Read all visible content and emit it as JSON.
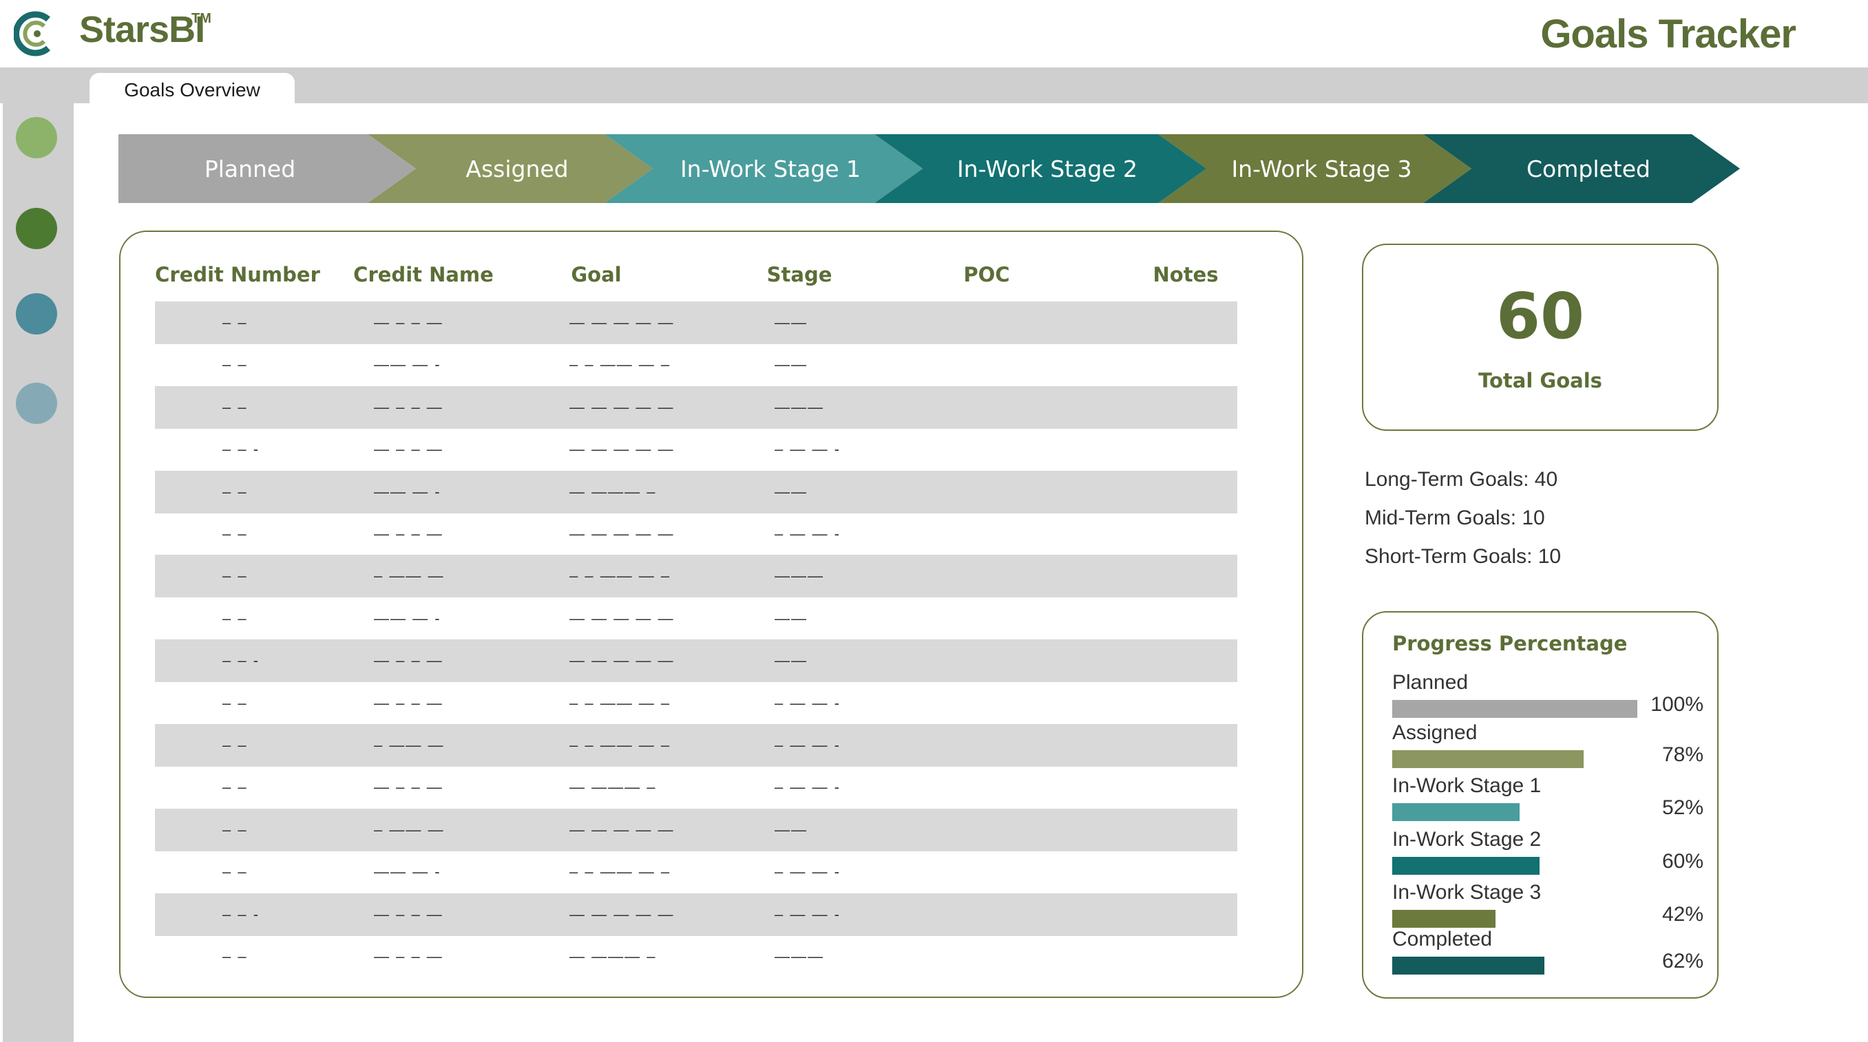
{
  "header": {
    "brand": "StarsBI",
    "trademark": "TM",
    "title": "Goals Tracker",
    "logo_icon": "starsbi-logo-icon"
  },
  "tabs": [
    {
      "label": "Goals Overview",
      "active": true
    }
  ],
  "sidebar": {
    "dots": [
      {
        "name": "nav-dot-1",
        "color": "#8db36a"
      },
      {
        "name": "nav-dot-2",
        "color": "#4c7a31"
      },
      {
        "name": "nav-dot-3",
        "color": "#4b8b9b"
      },
      {
        "name": "nav-dot-4",
        "color": "#86aab5"
      }
    ]
  },
  "stages": [
    {
      "label": "Planned",
      "color": "#a6a6a6"
    },
    {
      "label": "Assigned",
      "color": "#8c9660"
    },
    {
      "label": "In-Work Stage 1",
      "color": "#4a9d9d"
    },
    {
      "label": "In-Work Stage 2",
      "color": "#137171"
    },
    {
      "label": "In-Work Stage 3",
      "color": "#6c7a3d"
    },
    {
      "label": "Completed",
      "color": "#145b5b"
    }
  ],
  "table": {
    "columns": [
      "Credit Number",
      "Credit Name",
      "Goal",
      "Stage",
      "POC",
      "Notes"
    ],
    "rows": [
      [
        "– –",
        "— – – —",
        "— — — — —",
        "——",
        "",
        ""
      ],
      [
        "– –",
        "—— — -",
        "– – —— — –",
        "——",
        "",
        ""
      ],
      [
        "– –",
        "— – – —",
        "— — — — —",
        "———",
        "",
        ""
      ],
      [
        "– – -",
        "— – – —",
        "— — — — —",
        "– — — -",
        "",
        ""
      ],
      [
        "– –",
        "—— — -",
        "— ——— –",
        "——",
        "",
        ""
      ],
      [
        "– –",
        "— – – —",
        "— — — — —",
        "– — — -",
        "",
        ""
      ],
      [
        "– –",
        "– —— —",
        "– – —— — –",
        "———",
        "",
        ""
      ],
      [
        "– –",
        "—— — -",
        "— — — — —",
        "——",
        "",
        ""
      ],
      [
        "– – -",
        "— – – —",
        "— — — — —",
        "——",
        "",
        ""
      ],
      [
        "– –",
        "— – – —",
        "– – —— — –",
        "– — — -",
        "",
        ""
      ],
      [
        "– –",
        "– —— —",
        "– – —— — –",
        "– — — -",
        "",
        ""
      ],
      [
        "– –",
        "— – – —",
        "— ——— –",
        "– — — -",
        "",
        ""
      ],
      [
        "– –",
        "– —— —",
        "— — — — —",
        "——",
        "",
        ""
      ],
      [
        "– –",
        "—— — -",
        "– – —— — –",
        "– — — -",
        "",
        ""
      ],
      [
        "– – -",
        "— – – —",
        "— — — — —",
        "– — — -",
        "",
        ""
      ],
      [
        "– –",
        "— – – —",
        "— ——— –",
        "———",
        "",
        ""
      ]
    ]
  },
  "totals": {
    "number": "60",
    "label": "Total Goals",
    "long_term": "Long-Term Goals: 40",
    "mid_term": "Mid-Term Goals: 10",
    "short_term": "Short-Term Goals: 10"
  },
  "progress": {
    "title": "Progress Percentage",
    "items": [
      {
        "name": "Planned",
        "value": 100,
        "label": "100%",
        "color": "#a6a6a6"
      },
      {
        "name": "Assigned",
        "value": 78,
        "label": "78%",
        "color": "#8c9660"
      },
      {
        "name": "In-Work Stage 1",
        "value": 52,
        "label": "52%",
        "color": "#4a9d9d"
      },
      {
        "name": "In-Work Stage 2",
        "value": 60,
        "label": "60%",
        "color": "#137171"
      },
      {
        "name": "In-Work Stage 3",
        "value": 42,
        "label": "42%",
        "color": "#6c7a3d"
      },
      {
        "name": "Completed",
        "value": 62,
        "label": "62%",
        "color": "#145b5b"
      }
    ]
  }
}
